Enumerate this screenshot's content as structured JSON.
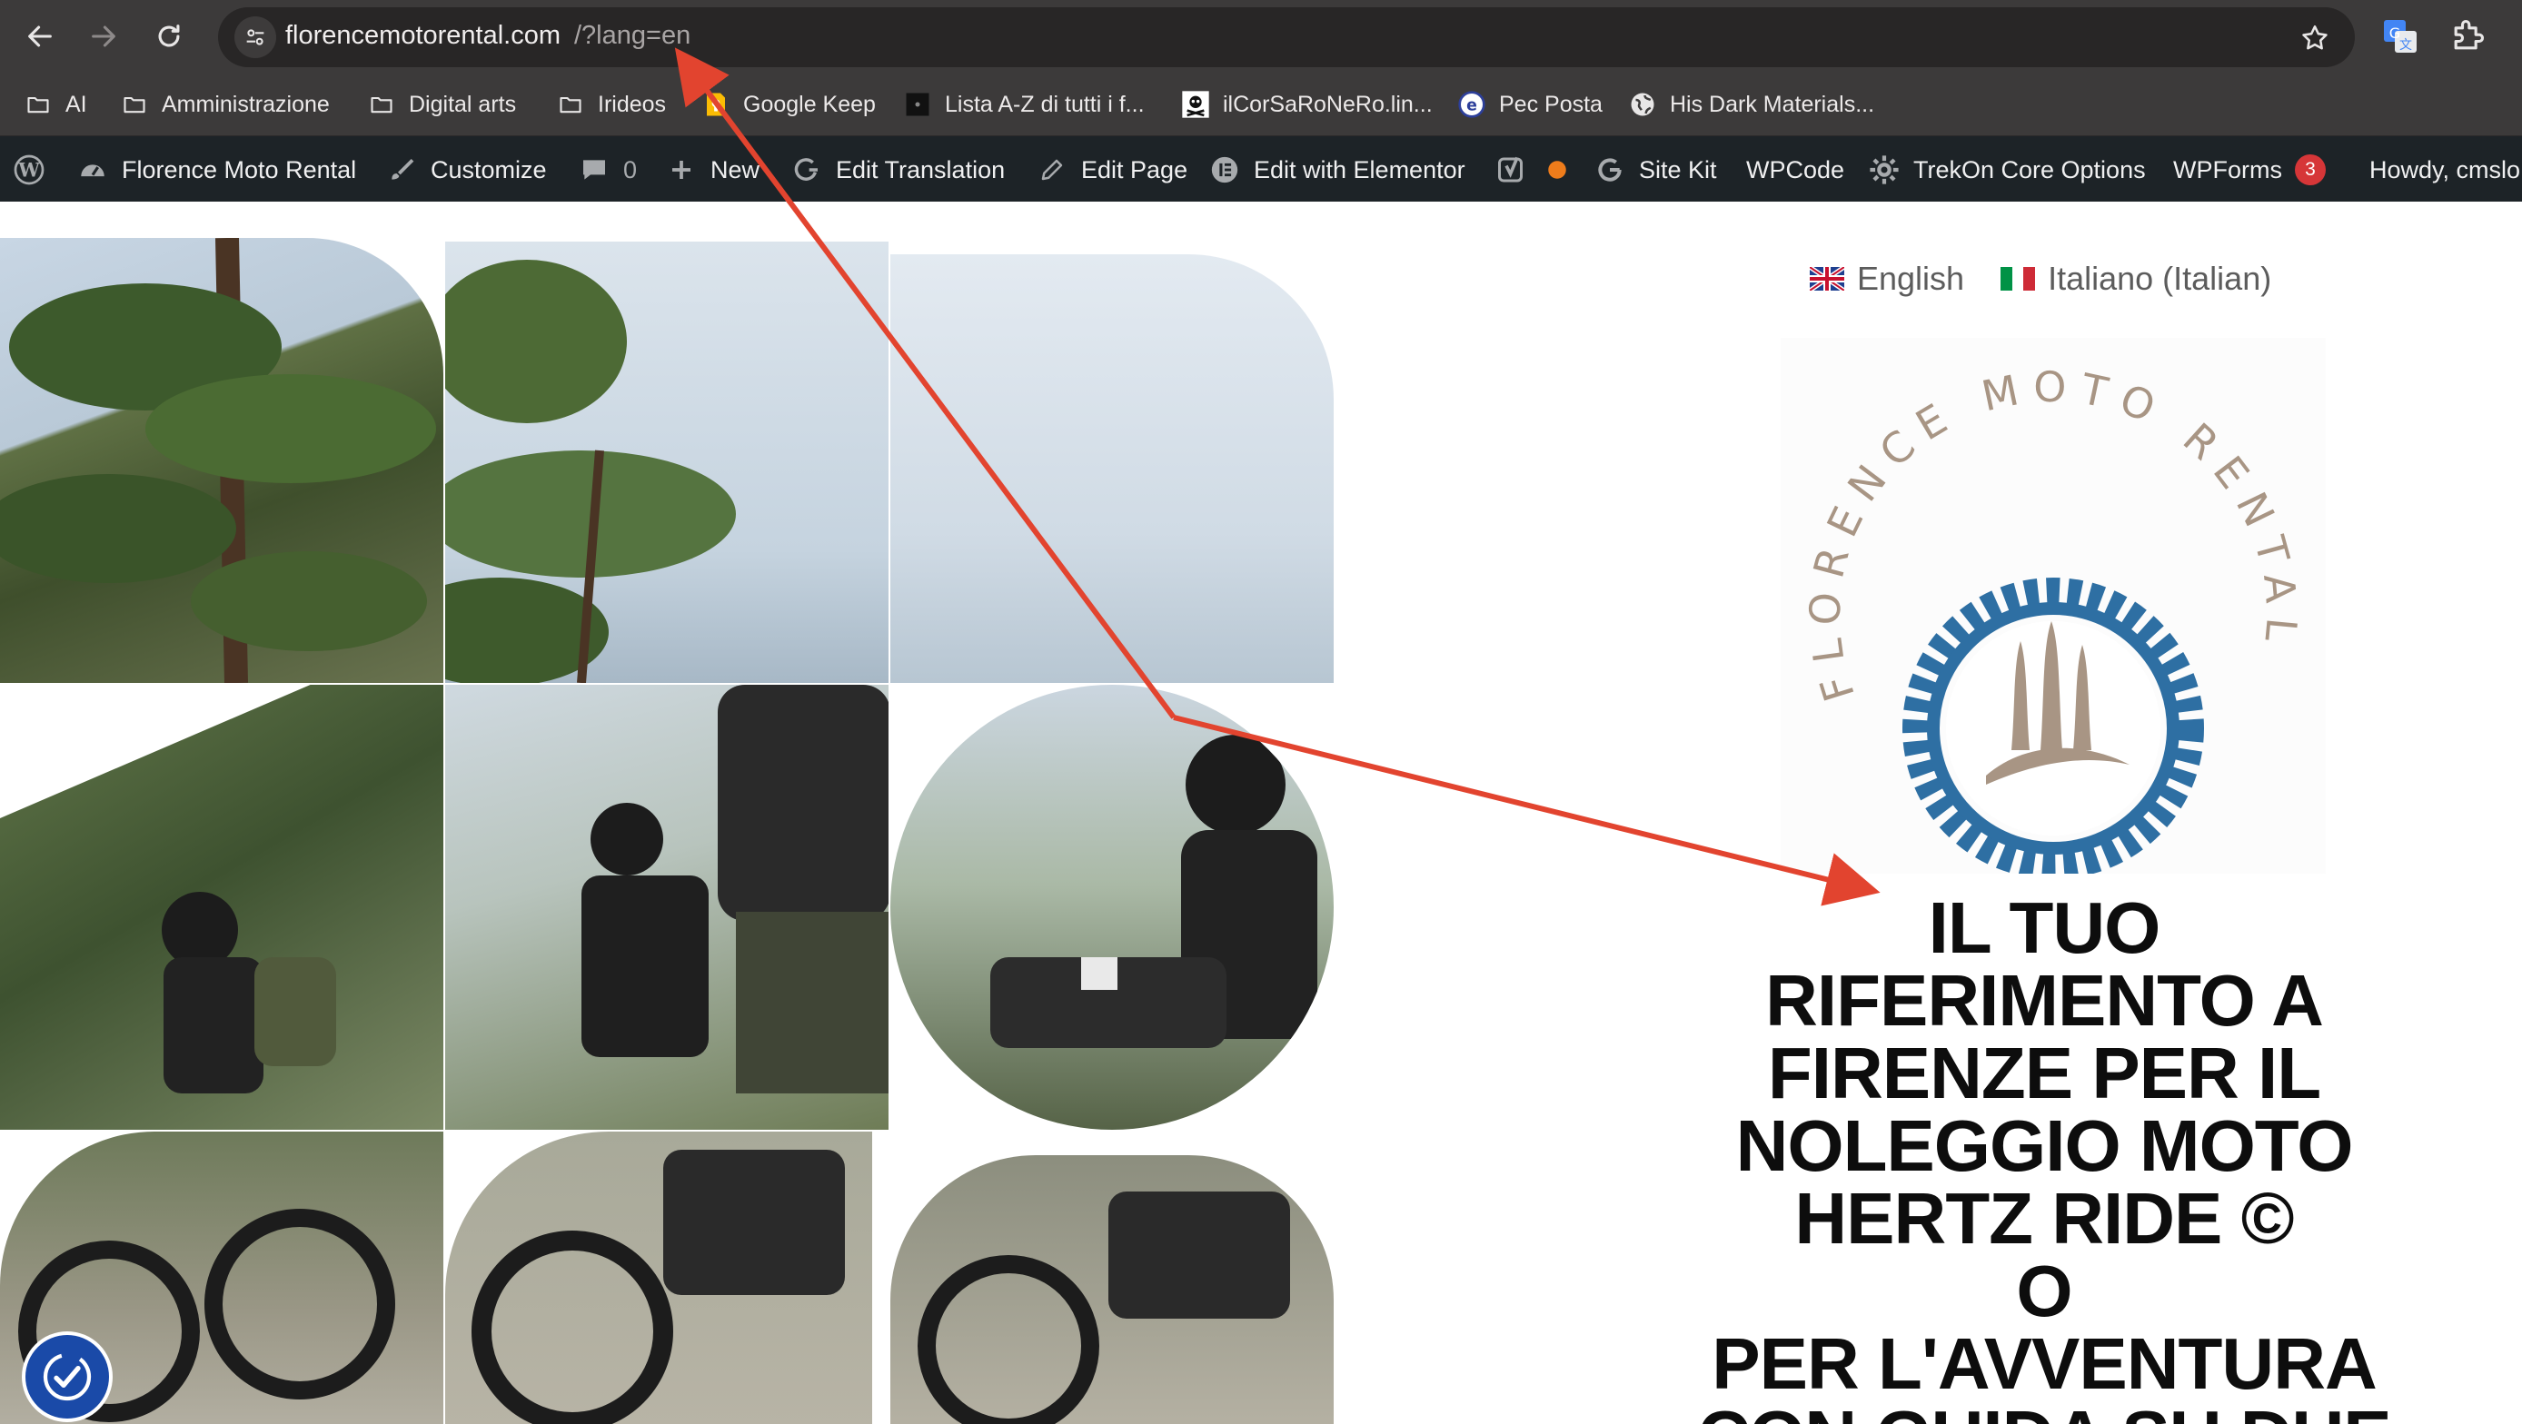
{
  "browser": {
    "url_host": "florencemotorental.com",
    "url_path": "/?lang=en",
    "bookmarks": [
      {
        "label": "AI",
        "icon": "folder-icon"
      },
      {
        "label": "Amministrazione",
        "icon": "folder-icon"
      },
      {
        "label": "Digital arts",
        "icon": "folder-icon"
      },
      {
        "label": "Irideos",
        "icon": "folder-icon"
      },
      {
        "label": "Google Keep",
        "icon": "google-keep-icon"
      },
      {
        "label": "Lista A-Z di tutti i f...",
        "icon": "site-favicon"
      },
      {
        "label": "ilCorSaRoNeRo.lin...",
        "icon": "pirate-favicon"
      },
      {
        "label": "Pec Posta",
        "icon": "pec-favicon"
      },
      {
        "label": "His Dark Materials...",
        "icon": "globe-icon"
      }
    ]
  },
  "admin_bar": {
    "site_name": "Florence Moto Rental",
    "customize": "Customize",
    "comments_count": "0",
    "new": "New",
    "edit_translation": "Edit Translation",
    "edit_page": "Edit Page",
    "edit_elementor": "Edit with Elementor",
    "site_kit": "Site Kit",
    "wpcode": "WPCode",
    "trekon": "TrekOn Core Options",
    "wpforms": "WPForms",
    "wpforms_count": "3",
    "howdy": "Howdy, cmslo"
  },
  "page": {
    "languages": [
      {
        "label": "English"
      },
      {
        "label": "Italiano (Italian)"
      }
    ],
    "logo_text": "FLORENCE MOTO RENTAL",
    "hero_lines": [
      "IL TUO",
      "RIFERIMENTO A",
      "FIRENZE PER IL",
      "NOLEGGIO MOTO",
      "HERTZ RIDE ©",
      "O",
      "PER L'AVVENTURA",
      "CON GUIDA SU DUE"
    ]
  },
  "colors": {
    "chrome": "#3c3a3a",
    "admin_bar": "#1d2327",
    "logo_blue": "#2e6fa3",
    "logo_tan": "#a89584",
    "arrow": "#e2442f",
    "a11y": "#1a4aa8"
  }
}
